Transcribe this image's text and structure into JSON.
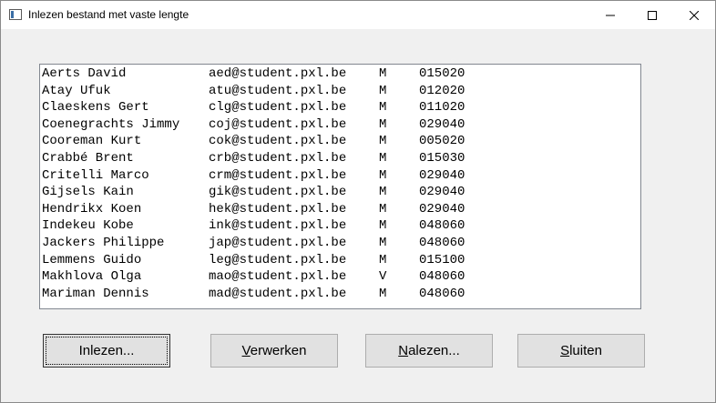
{
  "window": {
    "title": "Inlezen bestand met vaste lengte"
  },
  "list": {
    "rows": [
      {
        "name": "Aerts David",
        "email": "aed@student.pxl.be",
        "gender": "M",
        "code": "015020"
      },
      {
        "name": "Atay Ufuk",
        "email": "atu@student.pxl.be",
        "gender": "M",
        "code": "012020"
      },
      {
        "name": "Claeskens Gert",
        "email": "clg@student.pxl.be",
        "gender": "M",
        "code": "011020"
      },
      {
        "name": "Coenegrachts Jimmy",
        "email": "coj@student.pxl.be",
        "gender": "M",
        "code": "029040"
      },
      {
        "name": "Cooreman Kurt",
        "email": "cok@student.pxl.be",
        "gender": "M",
        "code": "005020"
      },
      {
        "name": "Crabbé Brent",
        "email": "crb@student.pxl.be",
        "gender": "M",
        "code": "015030"
      },
      {
        "name": "Critelli Marco",
        "email": "crm@student.pxl.be",
        "gender": "M",
        "code": "029040"
      },
      {
        "name": "Gijsels Kain",
        "email": "gik@student.pxl.be",
        "gender": "M",
        "code": "029040"
      },
      {
        "name": "Hendrikx Koen",
        "email": "hek@student.pxl.be",
        "gender": "M",
        "code": "029040"
      },
      {
        "name": "Indekeu Kobe",
        "email": "ink@student.pxl.be",
        "gender": "M",
        "code": "048060"
      },
      {
        "name": "Jackers Philippe",
        "email": "jap@student.pxl.be",
        "gender": "M",
        "code": "048060"
      },
      {
        "name": "Lemmens Guido",
        "email": "leg@student.pxl.be",
        "gender": "M",
        "code": "015100"
      },
      {
        "name": "Makhlova Olga",
        "email": "mao@student.pxl.be",
        "gender": "V",
        "code": "048060"
      },
      {
        "name": "Mariman Dennis",
        "email": "mad@student.pxl.be",
        "gender": "M",
        "code": "048060"
      }
    ]
  },
  "buttons": {
    "inlezen": {
      "mnemonic": "",
      "rest": "Inlezen..."
    },
    "verwerken": {
      "mnemonic": "V",
      "rest": "erwerken"
    },
    "nalezen": {
      "mnemonic": "N",
      "rest": "alezen..."
    },
    "sluiten": {
      "mnemonic": "S",
      "rest": "luiten"
    }
  },
  "icons": {
    "app": "window-app-icon",
    "minimize": "minimize-icon",
    "maximize": "maximize-icon",
    "close": "close-icon"
  }
}
